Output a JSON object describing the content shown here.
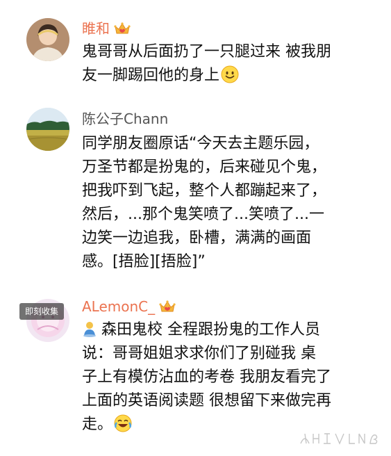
{
  "comments": [
    {
      "username": "睢和",
      "vip": true,
      "lines": [
        "鬼哥哥从后面扔了一只腿过来 被我朋",
        "友一脚踢回他的身上"
      ],
      "trailing_emoji": "smile-emoji"
    },
    {
      "username": "陈公子Chann",
      "vip": false,
      "lines": [
        "同学朋友圈原话“今天去主题乐园，",
        "万圣节都是扮鬼的，后来碰见个鬼，",
        "把我吓到飞起，整个人都蹦起来了，",
        "然后，...那个鬼笑喷了...笑喷了...一",
        "边笑一边追我，卧槽，满满的画面",
        "感。[捂脸][捂脸]”"
      ]
    },
    {
      "username": "ALemonC_",
      "vip": true,
      "leading_icon": "location-person-icon",
      "lines": [
        "森田鬼校 全程跟扮鬼的工作人员",
        "说：哥哥姐姐求求你们了别碰我  桌",
        "子上有模仿沾血的考卷 我朋友看完了",
        "上面的英语阅读题 很想留下来做完再",
        "走。"
      ],
      "trailing_emoji": "laugh-cry-emoji"
    }
  ],
  "collect_badge": "即刻收集",
  "colors": {
    "vip_name": "#eb7350",
    "plain_name": "#555555",
    "text": "#111111",
    "background": "#ffffff"
  }
}
